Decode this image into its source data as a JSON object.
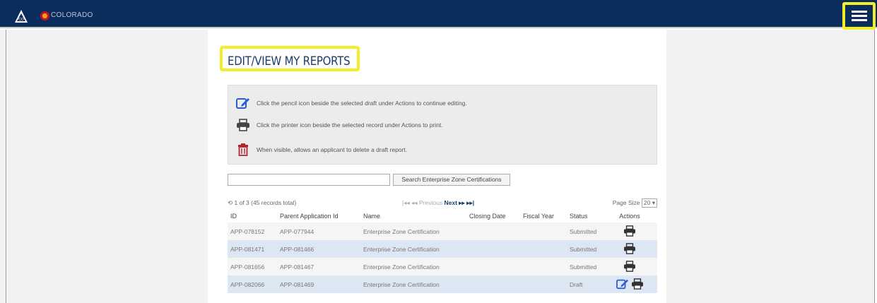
{
  "header": {
    "brand": "COLORADO",
    "colors": {
      "bar": "#0b2d5b",
      "highlight": "#f3ee2a"
    }
  },
  "page": {
    "title": "EDIT/VIEW MY REPORTS"
  },
  "info": {
    "pencil_text": "Click the pencil icon beside the selected draft under Actions to continue editing.",
    "printer_text": "Click the printer icon beside the selected record under Actions to print.",
    "delete_text": "When visible, allows an applicant to delete a draft report."
  },
  "search": {
    "value": "",
    "button_label": "Search Enterprise Zone Certifications"
  },
  "pager": {
    "record_count": "1 of 3 (45 records total)",
    "first": "⏮",
    "prev_label": "Previous",
    "next_label": "Next",
    "last": "⏭",
    "page_size_label": "Page Size",
    "page_size_value": "20"
  },
  "table": {
    "columns": [
      "ID",
      "Parent Application Id",
      "Name",
      "Closing Date",
      "Fiscal Year",
      "Status",
      "Actions"
    ],
    "rows": [
      {
        "id": "APP-078152",
        "parent": "APP-077944",
        "name": "Enterprise Zone Certification",
        "closing": "",
        "fiscal": "",
        "status": "Submitted",
        "actions": [
          "printer-icon"
        ]
      },
      {
        "id": "APP-081471",
        "parent": "APP-081466",
        "name": "Enterprise Zone Certification",
        "closing": "",
        "fiscal": "",
        "status": "Submitted",
        "actions": [
          "printer-icon"
        ]
      },
      {
        "id": "APP-081656",
        "parent": "APP-081467",
        "name": "Enterprise Zone Certification",
        "closing": "",
        "fiscal": "",
        "status": "Submitted",
        "actions": [
          "printer-icon"
        ]
      },
      {
        "id": "APP-082066",
        "parent": "APP-081469",
        "name": "Enterprise Zone Certification",
        "closing": "",
        "fiscal": "",
        "status": "Draft",
        "actions": [
          "pencil-icon",
          "printer-icon"
        ]
      }
    ]
  }
}
